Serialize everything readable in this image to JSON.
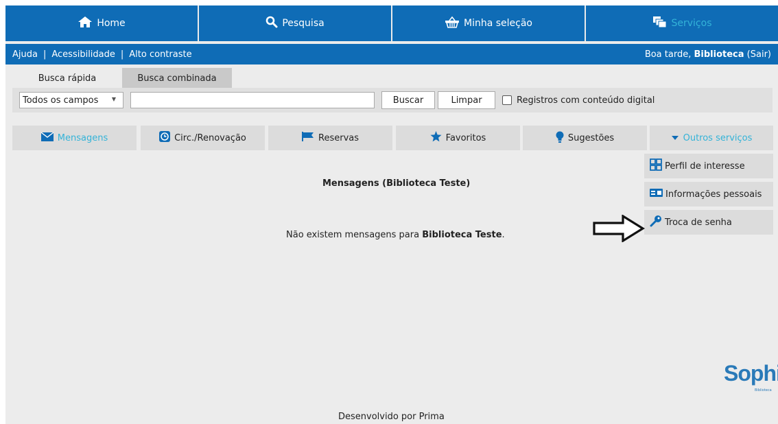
{
  "colors": {
    "primary": "#0f6cb6",
    "accent_text": "#33b3d8"
  },
  "topnav": [
    {
      "label": "Home",
      "icon": "home-icon"
    },
    {
      "label": "Pesquisa",
      "icon": "search-icon"
    },
    {
      "label": "Minha seleção",
      "icon": "basket-icon"
    },
    {
      "label": "Serviços",
      "icon": "windows-icon"
    }
  ],
  "subbar": {
    "links": [
      "Ajuda",
      "Acessibilidade",
      "Alto contraste"
    ],
    "separator": "|",
    "greeting": "Boa tarde,",
    "user": "Biblioteca",
    "logout": "(Sair)"
  },
  "search": {
    "tabs": [
      "Busca rápida",
      "Busca combinada"
    ],
    "field_select": "Todos os campos",
    "query_value": "",
    "buscar_label": "Buscar",
    "limpar_label": "Limpar",
    "digital_label": "Registros com conteúdo digital"
  },
  "services": [
    {
      "label": "Mensagens",
      "icon": "envelope-icon"
    },
    {
      "label": "Circ./Renovação",
      "icon": "clock-icon"
    },
    {
      "label": "Reservas",
      "icon": "flag-icon"
    },
    {
      "label": "Favoritos",
      "icon": "star-icon"
    },
    {
      "label": "Sugestões",
      "icon": "lightbulb-icon"
    },
    {
      "label": "Outros serviços",
      "icon": "caret-down-icon"
    }
  ],
  "menu": [
    {
      "label": "Perfil de interesse",
      "icon": "grid-icon"
    },
    {
      "label": "Informações pessoais",
      "icon": "id-card-icon"
    },
    {
      "label": "Troca de senha",
      "icon": "key-icon"
    }
  ],
  "main": {
    "title": "Mensagens (Biblioteca Teste)",
    "message_prefix": "Não existem mensagens para",
    "message_name": "Biblioteca Teste",
    "message_suffix": "."
  },
  "logo": {
    "text": "SophiA",
    "subtext": "Biblioteca"
  },
  "footer": "Desenvolvido por Prima"
}
